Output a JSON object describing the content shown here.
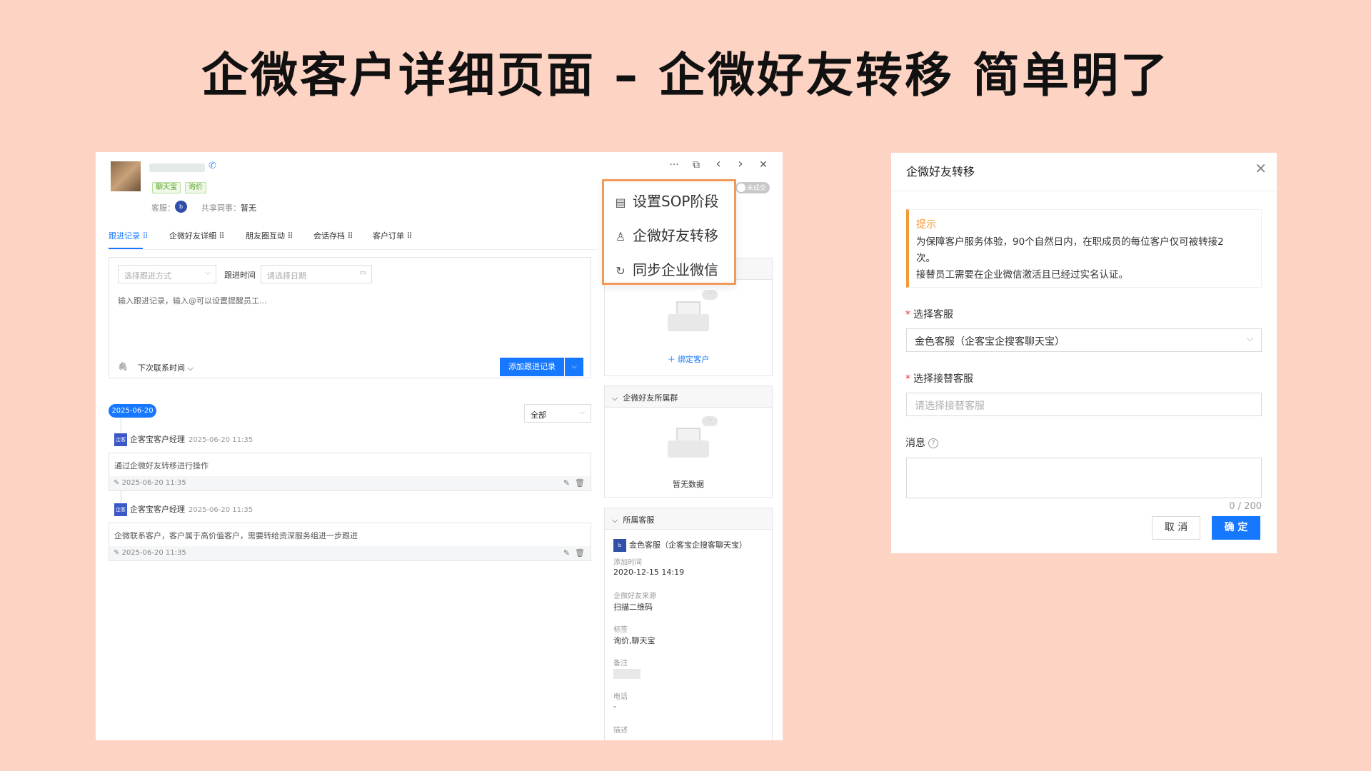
{
  "page": {
    "title": "企微客户详细页面 – 企微好友转移 简单明了"
  },
  "customer": {
    "tags": [
      "聊天宝",
      "询价"
    ],
    "kefu_label": "客服：",
    "kefu_avatar": "b",
    "share_label": "共享同事：",
    "share_value": "暂无",
    "status_toggle": "未成交"
  },
  "toolbar": {
    "more": "···",
    "open": "⧉",
    "prev": "‹",
    "next": "›",
    "close": "✕"
  },
  "tabs": [
    {
      "label": "跟进记录",
      "active": true
    },
    {
      "label": "企微好友详细",
      "active": false
    },
    {
      "label": "朋友圈互动",
      "active": false
    },
    {
      "label": "会话存档",
      "active": false
    },
    {
      "label": "客户订单",
      "active": false
    }
  ],
  "record_form": {
    "method_placeholder": "选择跟进方式",
    "time_label": "跟进时间",
    "date_placeholder": "请选择日期",
    "content_placeholder": "输入跟进记录，输入@可以设置提醒员工...",
    "next_contact": "下次联系时间",
    "add_button": "添加跟进记录"
  },
  "timeline": {
    "date": "2025-06-20",
    "filter": "全部",
    "entries": [
      {
        "avatar": "企客宝",
        "author": "企客宝客户经理",
        "time": "2025-06-20 11:35",
        "content": "通过企微好友转移进行操作",
        "footer": "2025-06-20 11:35"
      },
      {
        "avatar": "企客宝",
        "author": "企客宝客户经理",
        "time": "2025-06-20 11:35",
        "content": "企微联系客户，客户属于高价值客户，需要转给资深服务组进一步跟进",
        "footer": "2025-06-20 11:35"
      }
    ]
  },
  "dropdown": {
    "items": [
      {
        "icon": "sop-icon",
        "label": "设置SOP阶段"
      },
      {
        "icon": "user-transfer-icon",
        "label": "企微好友转移"
      },
      {
        "icon": "sync-icon",
        "label": "同步企业微信"
      }
    ]
  },
  "side": {
    "bind_link": "绑定客户",
    "groups_title": "企微好友所属群",
    "groups_empty": "暂无数据",
    "kefu_title": "所属客服",
    "kefu_name": "金色客服（企客宝企搜客聊天宝）",
    "fields": [
      {
        "label": "添加时间",
        "value": "2020-12-15 14:19"
      },
      {
        "label": "企微好友来源",
        "value": "扫描二维码"
      },
      {
        "label": "标签",
        "value": "询价,聊天宝"
      },
      {
        "label": "备注",
        "value": ""
      },
      {
        "label": "电话",
        "value": "-"
      },
      {
        "label": "描述",
        "value": ""
      }
    ]
  },
  "modal": {
    "title": "企微好友转移",
    "notice_title": "提示",
    "notice_lines": [
      "为保障客户服务体验，90个自然日内，在职成员的每位客户仅可被转接2",
      "次。",
      "接替员工需要在企业微信激活且已经过实名认证。"
    ],
    "kefu_label": "选择客服",
    "kefu_value": "金色客服（企客宝企搜客聊天宝）",
    "replace_label": "选择接替客服",
    "replace_placeholder": "请选择接替客服",
    "message_label": "消息",
    "counter": "0 / 200",
    "cancel": "取 消",
    "confirm": "确 定"
  }
}
